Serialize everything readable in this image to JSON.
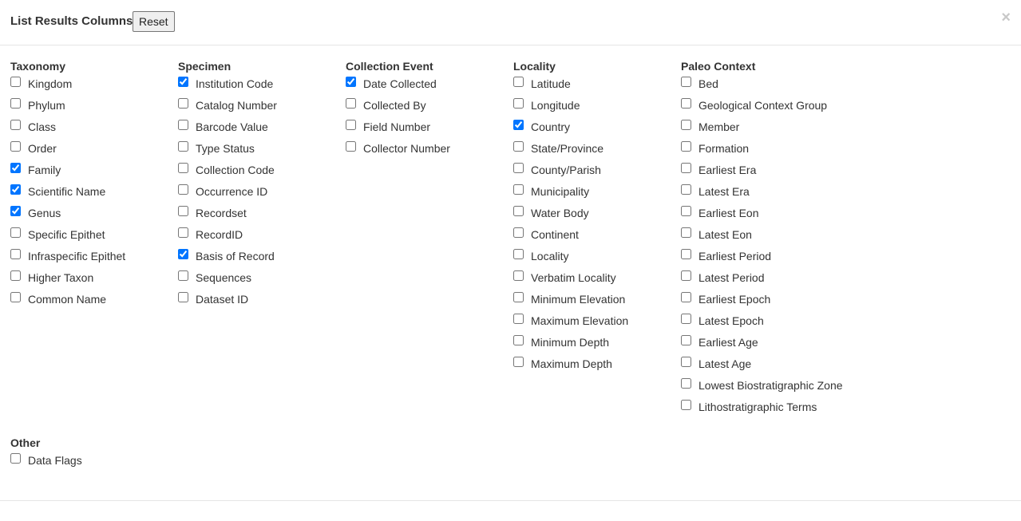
{
  "header": {
    "title": "List Results Columns",
    "reset_label": "Reset",
    "close_label": "×"
  },
  "groups": [
    {
      "heading": "Taxonomy",
      "items": [
        {
          "label": "Kingdom",
          "checked": false
        },
        {
          "label": "Phylum",
          "checked": false
        },
        {
          "label": "Class",
          "checked": false
        },
        {
          "label": "Order",
          "checked": false
        },
        {
          "label": "Family",
          "checked": true
        },
        {
          "label": "Scientific Name",
          "checked": true
        },
        {
          "label": "Genus",
          "checked": true
        },
        {
          "label": "Specific Epithet",
          "checked": false
        },
        {
          "label": "Infraspecific Epithet",
          "checked": false
        },
        {
          "label": "Higher Taxon",
          "checked": false
        },
        {
          "label": "Common Name",
          "checked": false
        }
      ]
    },
    {
      "heading": "Specimen",
      "items": [
        {
          "label": "Institution Code",
          "checked": true
        },
        {
          "label": "Catalog Number",
          "checked": false
        },
        {
          "label": "Barcode Value",
          "checked": false
        },
        {
          "label": "Type Status",
          "checked": false
        },
        {
          "label": "Collection Code",
          "checked": false
        },
        {
          "label": "Occurrence ID",
          "checked": false
        },
        {
          "label": "Recordset",
          "checked": false
        },
        {
          "label": "RecordID",
          "checked": false
        },
        {
          "label": "Basis of Record",
          "checked": true
        },
        {
          "label": "Sequences",
          "checked": false
        },
        {
          "label": "Dataset ID",
          "checked": false
        }
      ]
    },
    {
      "heading": "Collection Event",
      "items": [
        {
          "label": "Date Collected",
          "checked": true
        },
        {
          "label": "Collected By",
          "checked": false
        },
        {
          "label": "Field Number",
          "checked": false
        },
        {
          "label": "Collector Number",
          "checked": false
        }
      ]
    },
    {
      "heading": "Locality",
      "items": [
        {
          "label": "Latitude",
          "checked": false
        },
        {
          "label": "Longitude",
          "checked": false
        },
        {
          "label": "Country",
          "checked": true
        },
        {
          "label": "State/Province",
          "checked": false
        },
        {
          "label": "County/Parish",
          "checked": false
        },
        {
          "label": "Municipality",
          "checked": false
        },
        {
          "label": "Water Body",
          "checked": false
        },
        {
          "label": "Continent",
          "checked": false
        },
        {
          "label": "Locality",
          "checked": false
        },
        {
          "label": "Verbatim Locality",
          "checked": false
        },
        {
          "label": "Minimum Elevation",
          "checked": false
        },
        {
          "label": "Maximum Elevation",
          "checked": false
        },
        {
          "label": "Minimum Depth",
          "checked": false
        },
        {
          "label": "Maximum Depth",
          "checked": false
        }
      ]
    },
    {
      "heading": "Paleo Context",
      "items": [
        {
          "label": "Bed",
          "checked": false
        },
        {
          "label": "Geological Context Group",
          "checked": false
        },
        {
          "label": "Member",
          "checked": false
        },
        {
          "label": "Formation",
          "checked": false
        },
        {
          "label": "Earliest Era",
          "checked": false
        },
        {
          "label": "Latest Era",
          "checked": false
        },
        {
          "label": "Earliest Eon",
          "checked": false
        },
        {
          "label": "Latest Eon",
          "checked": false
        },
        {
          "label": "Earliest Period",
          "checked": false
        },
        {
          "label": "Latest Period",
          "checked": false
        },
        {
          "label": "Earliest Epoch",
          "checked": false
        },
        {
          "label": "Latest Epoch",
          "checked": false
        },
        {
          "label": "Earliest Age",
          "checked": false
        },
        {
          "label": "Latest Age",
          "checked": false
        },
        {
          "label": "Lowest Biostratigraphic Zone",
          "checked": false
        },
        {
          "label": "Lithostratigraphic Terms",
          "checked": false
        }
      ]
    },
    {
      "heading": "Other",
      "items": [
        {
          "label": "Data Flags",
          "checked": false
        }
      ]
    }
  ]
}
